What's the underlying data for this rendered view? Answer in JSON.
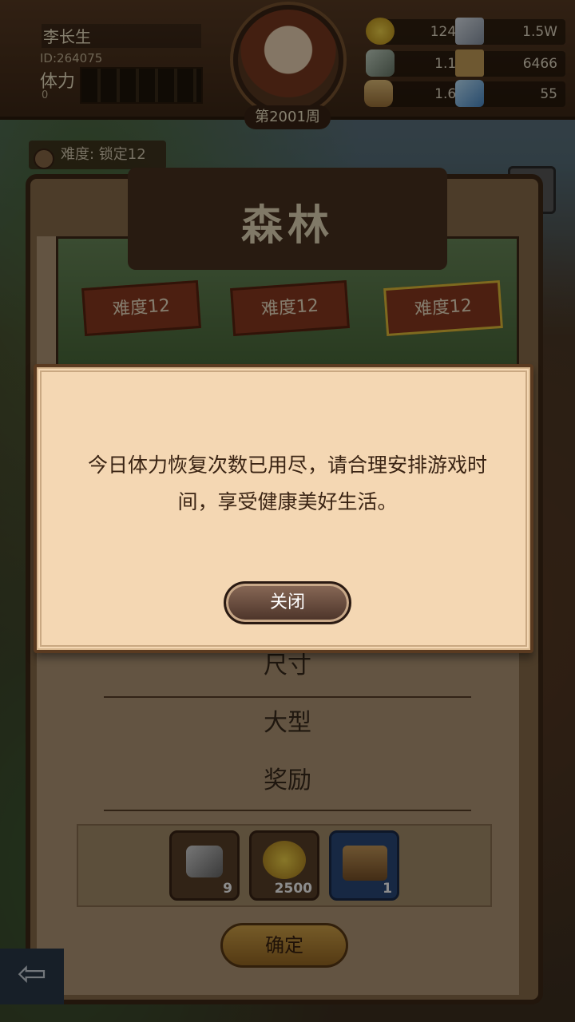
{
  "player": {
    "name": "李长生",
    "id": "ID:264075",
    "stamina_label": "体力",
    "stamina_value": "0",
    "week": "第2001周"
  },
  "resources": [
    {
      "icon": "gold-coin-icon",
      "value": "124W"
    },
    {
      "icon": "iron-ingot-icon",
      "value": "1.5W"
    },
    {
      "icon": "stone-ore-icon",
      "value": "1.1W"
    },
    {
      "icon": "map-scroll-icon",
      "value": "6466"
    },
    {
      "icon": "wood-log-icon",
      "value": "1.6W"
    },
    {
      "icon": "crystal-icon",
      "value": "55"
    }
  ],
  "difficulty_tag": "难度: 锁定12",
  "panel": {
    "title": "森林",
    "cards": [
      "难度12",
      "难度12",
      "难度12"
    ],
    "size_label": "尺寸",
    "size_value": "大型",
    "reward_label": "奖励",
    "rewards": [
      {
        "icon": "ore-icon",
        "count": "9"
      },
      {
        "icon": "gold-bag-icon",
        "count": "2500"
      },
      {
        "icon": "treasure-chest-icon",
        "count": "1"
      }
    ],
    "confirm_label": "确定"
  },
  "back_label": "⇦",
  "modal": {
    "message": "今日体力恢复次数已用尽，请合理安排游戏时间，享受健康美好生活。",
    "close_label": "关闭"
  },
  "colors": {
    "gold": "#e6c23a",
    "modal_bg": "#f4d7b3",
    "frame": "#3e2816"
  }
}
